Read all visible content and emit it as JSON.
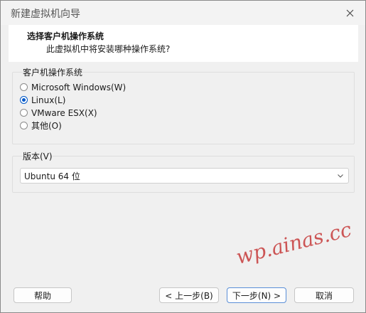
{
  "window": {
    "title": "新建虚拟机向导",
    "close_icon": "close-icon"
  },
  "header": {
    "title": "选择客户机操作系统",
    "subtitle": "此虚拟机中将安装哪种操作系统?"
  },
  "os_group": {
    "label": "客户机操作系统",
    "options": [
      {
        "label": "Microsoft Windows(W)",
        "checked": false
      },
      {
        "label": "Linux(L)",
        "checked": true
      },
      {
        "label": "VMware ESX(X)",
        "checked": false
      },
      {
        "label": "其他(O)",
        "checked": false
      }
    ]
  },
  "version_group": {
    "label": "版本(V)",
    "selected": "Ubuntu 64 位"
  },
  "footer": {
    "help": "帮助",
    "back": "< 上一步(B)",
    "next": "下一步(N) >",
    "cancel": "取消"
  },
  "watermark": "wp.ainas.cc",
  "colors": {
    "accent": "#0058c8",
    "watermark": "#c63a3a"
  }
}
